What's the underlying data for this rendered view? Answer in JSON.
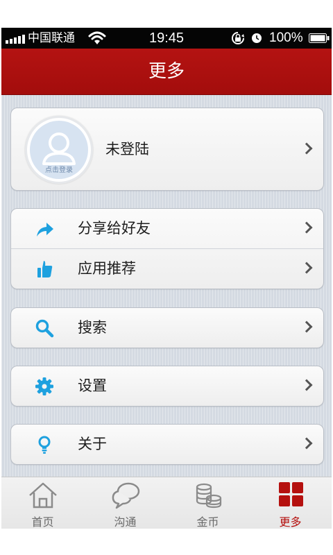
{
  "status_bar": {
    "carrier": "中国联通",
    "time": "19:45",
    "battery": "100%"
  },
  "nav": {
    "title": "更多"
  },
  "profile": {
    "name": "未登陆",
    "avatar_caption": "点击登录"
  },
  "menu": {
    "share": "分享给好友",
    "recommend": "应用推荐",
    "search": "搜索",
    "settings": "设置",
    "about": "关于"
  },
  "tabs": [
    {
      "label": "首页",
      "icon": "home-icon"
    },
    {
      "label": "沟通",
      "icon": "chat-bubbles-icon"
    },
    {
      "label": "金币",
      "icon": "coins-icon"
    },
    {
      "label": "更多",
      "icon": "grid-icon"
    }
  ],
  "colors": {
    "nav_red": "#b41312",
    "icon_blue": "#1ea1df",
    "active_tab": "#b5110f"
  }
}
